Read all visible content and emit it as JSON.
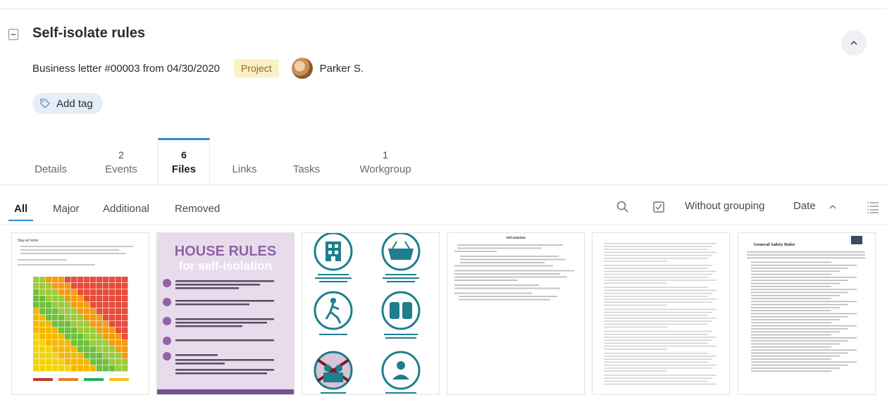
{
  "header": {
    "title": "Self-isolate rules",
    "document": "Business letter #00003 from 04/30/2020",
    "badge": "Project",
    "person": "Parker S.",
    "add_tag": "Add tag"
  },
  "tabs": [
    {
      "label": "Details",
      "count": ""
    },
    {
      "label": "Events",
      "count": "2"
    },
    {
      "label": "Files",
      "count": "6"
    },
    {
      "label": "Links",
      "count": ""
    },
    {
      "label": "Tasks",
      "count": ""
    },
    {
      "label": "Workgroup",
      "count": "1"
    }
  ],
  "active_tab": "Files",
  "subtabs": [
    "All",
    "Major",
    "Additional",
    "Removed"
  ],
  "toolbar": {
    "grouping": "Without grouping",
    "sort": "Date"
  },
  "files": [
    {
      "kind": "risk-matrix-sheet",
      "heading": "Stay at home"
    },
    {
      "kind": "house-rules-poster",
      "heading": "HOUSE RULES",
      "subheading": "for self-isolation"
    },
    {
      "kind": "icon-guidelines-sheet"
    },
    {
      "kind": "text-document",
      "heading": "Self-isolation"
    },
    {
      "kind": "text-document-dense"
    },
    {
      "kind": "safety-rules-document",
      "heading": "General Safety Rules"
    }
  ],
  "colors": {
    "accent": "#2a8dd4",
    "badge_bg": "#fbf0c7",
    "tag_bg": "#e3eef8",
    "poster_purple": "#8f63a6",
    "poster_bg": "#e8dcec",
    "icon_teal": "#1e7e8c"
  }
}
